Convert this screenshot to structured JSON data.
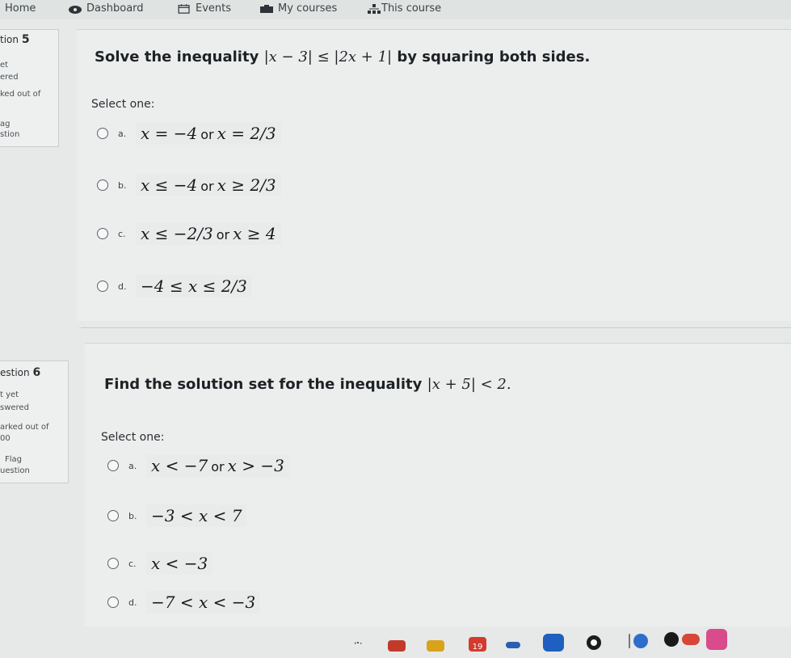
{
  "nav": {
    "items": [
      {
        "label": "Home",
        "icon": "home-icon"
      },
      {
        "label": "Dashboard",
        "icon": "dashboard-icon"
      },
      {
        "label": "Events",
        "icon": "calendar-icon"
      },
      {
        "label": "My courses",
        "icon": "courses-icon"
      },
      {
        "label": "This course",
        "icon": "course-hierarchy-icon"
      }
    ]
  },
  "q5": {
    "info": {
      "number_prefix": "tion",
      "number": "5",
      "status_1": "et",
      "status_2": "ered",
      "marked": "ked out of",
      "flag_1": "ag",
      "flag_2": "stion"
    },
    "text_before": "Solve the inequality ",
    "math": "|x − 3| ≤ |2x + 1|",
    "text_after": " by squaring both sides.",
    "select_label": "Select one:",
    "options": [
      {
        "letter": "a.",
        "expr": "x = −4",
        "joiner": "or",
        "expr2": "x = 2/3"
      },
      {
        "letter": "b.",
        "expr": "x ≤ −4",
        "joiner": "or",
        "expr2": "x ≥ 2/3"
      },
      {
        "letter": "c.",
        "expr": "x ≤ −2/3",
        "joiner": "or",
        "expr2": "x ≥ 4"
      },
      {
        "letter": "d.",
        "expr": "−4 ≤ x ≤ 2/3",
        "joiner": "",
        "expr2": ""
      }
    ]
  },
  "q6": {
    "info": {
      "number_prefix": "estion",
      "number": "6",
      "status_1": "t yet",
      "status_2": "swered",
      "marked": "arked out of",
      "marked_value": "00",
      "flag_1": "Flag",
      "flag_2": "uestion"
    },
    "text_before": "Find the solution set for the inequality ",
    "math": "|x + 5| < 2.",
    "text_after": "",
    "select_label": "Select one:",
    "options": [
      {
        "letter": "a.",
        "expr": "x < −7",
        "joiner": "or",
        "expr2": "x > −3"
      },
      {
        "letter": "b.",
        "expr": "−3 < x < 7",
        "joiner": "",
        "expr2": ""
      },
      {
        "letter": "c.",
        "expr": "x < −3",
        "joiner": "",
        "expr2": ""
      },
      {
        "letter": "d.",
        "expr": "−7 < x < −3",
        "joiner": "",
        "expr2": ""
      }
    ]
  },
  "taskbar": {
    "calendar_day": "19"
  }
}
